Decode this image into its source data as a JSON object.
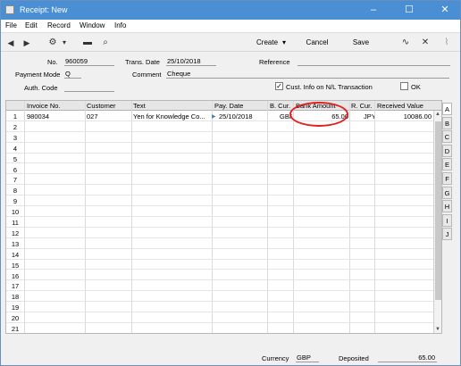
{
  "window": {
    "title": "Receipt: New"
  },
  "window_controls": {
    "minimize": "–",
    "maximize": "☐",
    "close": "✕"
  },
  "menu": [
    "File",
    "Edit",
    "Record",
    "Window",
    "Info"
  ],
  "toolbar": {
    "create": "Create",
    "create_caret": "▾",
    "cancel": "Cancel",
    "save": "Save"
  },
  "header": {
    "no_label": "No.",
    "no_value": "960059",
    "trans_date_label": "Trans. Date",
    "trans_date_value": "25/10/2018",
    "reference_label": "Reference",
    "reference_value": "",
    "payment_mode_label": "Payment Mode",
    "payment_mode_value": "Q",
    "comment_label": "Comment",
    "comment_value": "Cheque",
    "auth_code_label": "Auth. Code",
    "auth_code_value": "",
    "cust_info_label": "Cust. Info on N/L Transaction",
    "cust_info_checked": "✓",
    "ok_label": "OK"
  },
  "grid": {
    "columns": [
      "Invoice No.",
      "Customer",
      "Text",
      "Pay. Date",
      "B. Cur.",
      "Bank Amount",
      "R. Cur.",
      "Received Value"
    ],
    "rows": [
      {
        "n": "1",
        "invoice": "980034",
        "customer": "027",
        "text": "Yen for Knowledge Co...",
        "pay_date": "25/10/2018",
        "bcur": "GBP",
        "bank_amount": "65.00",
        "rcur": "JPY",
        "received": "10086.00"
      },
      {
        "n": "2"
      },
      {
        "n": "3"
      },
      {
        "n": "4"
      },
      {
        "n": "5"
      },
      {
        "n": "6"
      },
      {
        "n": "7"
      },
      {
        "n": "8"
      },
      {
        "n": "9"
      },
      {
        "n": "10"
      },
      {
        "n": "11"
      },
      {
        "n": "12"
      },
      {
        "n": "13"
      },
      {
        "n": "14"
      },
      {
        "n": "15"
      },
      {
        "n": "16"
      },
      {
        "n": "17"
      },
      {
        "n": "18"
      },
      {
        "n": "19"
      },
      {
        "n": "20"
      },
      {
        "n": "21"
      }
    ]
  },
  "tabs": [
    "A",
    "B",
    "C",
    "D",
    "E",
    "F",
    "G",
    "H",
    "I",
    "J"
  ],
  "footer": {
    "currency_label": "Currency",
    "currency_value": "GBP",
    "deposited_label": "Deposited",
    "deposited_value": "65.00"
  },
  "icons": {
    "back": "◀",
    "forward": "▶",
    "gear": "⚙",
    "gear_caret": "▾",
    "print": "▬",
    "preview": "⌕",
    "activity": "∿",
    "shrink": "✕",
    "attach": "⌇"
  }
}
